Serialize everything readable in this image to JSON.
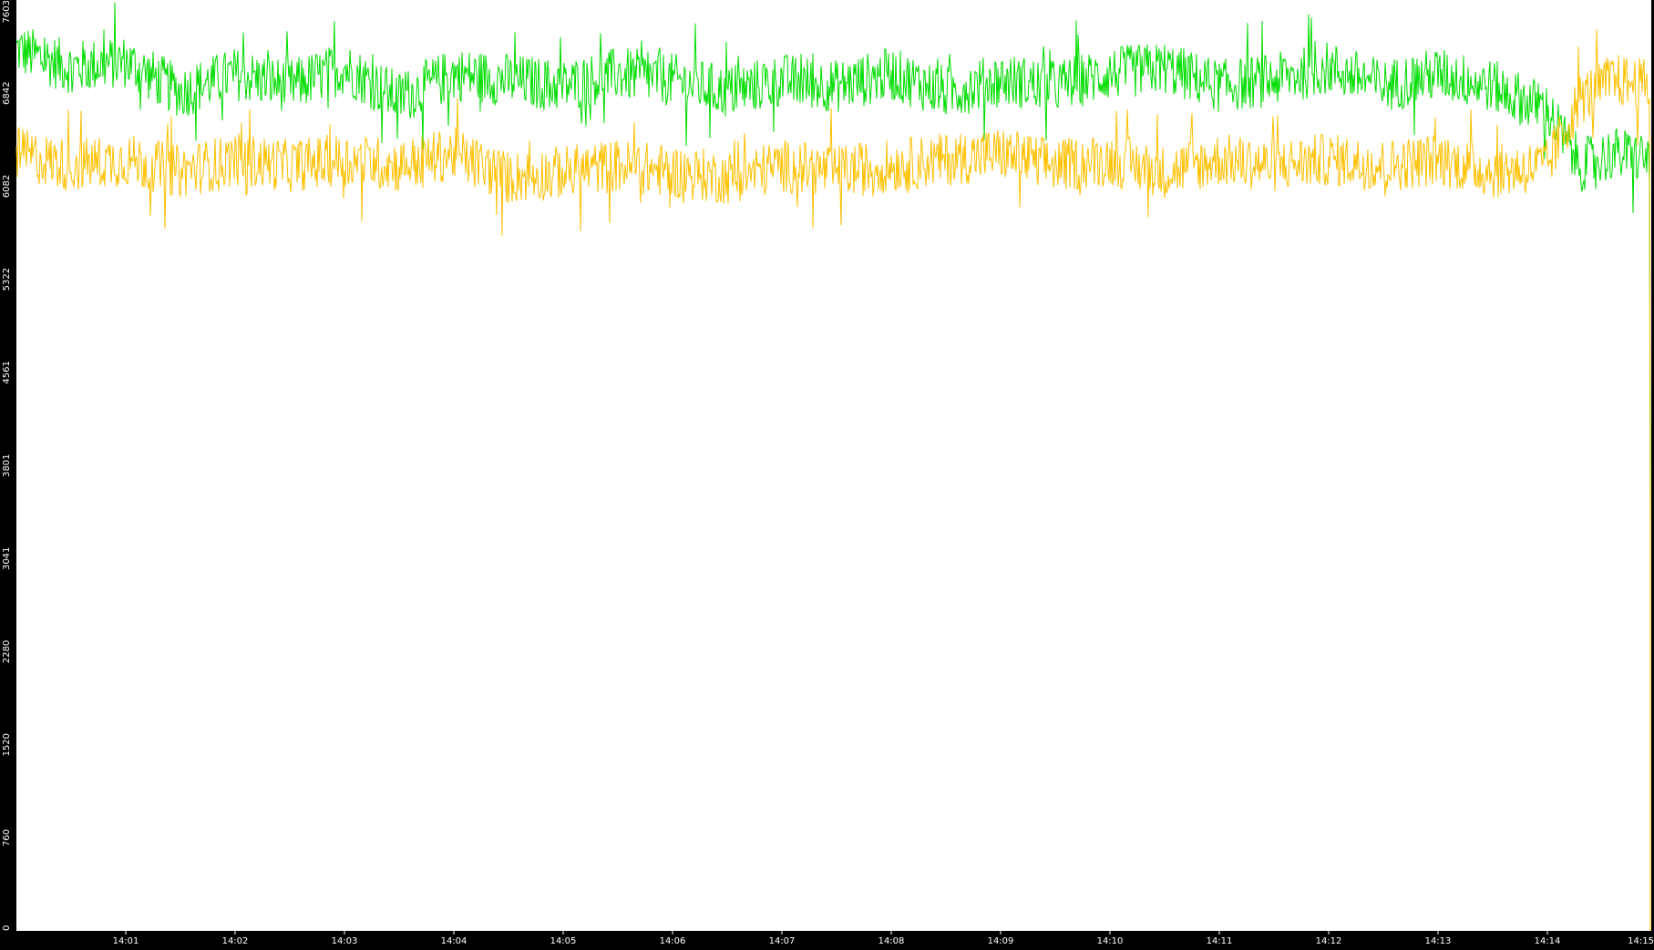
{
  "chart_data": {
    "type": "line",
    "title": "",
    "xlabel": "",
    "ylabel": "",
    "grid": false,
    "legend": "none",
    "ylim": [
      0,
      7603
    ],
    "xlim_minutes": [
      0.0,
      14.95
    ],
    "y_ticks": [
      0,
      760,
      1520,
      2280,
      3041,
      3801,
      4561,
      5322,
      6082,
      6842,
      7603
    ],
    "y_tick_labels": [
      "0",
      "760",
      "1520",
      "2280",
      "3041",
      "3801",
      "4561",
      "5322",
      "6082",
      "6842",
      "7603"
    ],
    "x_ticks_minutes": [
      1,
      2,
      3,
      4,
      5,
      6,
      7,
      8,
      9,
      10,
      11,
      12,
      13,
      14,
      15
    ],
    "x_tick_labels": [
      "14:01",
      "14:02",
      "14:03",
      "14:04",
      "14:05",
      "14:06",
      "14:07",
      "14:08",
      "14:09",
      "14:10",
      "14:11",
      "14:12",
      "14:13",
      "14:14",
      "14:15"
    ],
    "colors": {
      "plot_background": "#FFFFFF",
      "frame": "#000000",
      "tick_text": "#FFFFFF"
    },
    "series": [
      {
        "color": "#00DD00",
        "end_drop": [
          3400,
          3030
        ],
        "points": [
          [
            0.0,
            7200
          ],
          [
            0.5,
            7050
          ],
          [
            1.0,
            7100
          ],
          [
            1.5,
            6850
          ],
          [
            2.0,
            7000
          ],
          [
            2.5,
            6900
          ],
          [
            3.0,
            7050
          ],
          [
            3.5,
            6800
          ],
          [
            4.0,
            7000
          ],
          [
            4.5,
            6950
          ],
          [
            5.0,
            6900
          ],
          [
            5.5,
            7000
          ],
          [
            6.0,
            6950
          ],
          [
            6.5,
            6850
          ],
          [
            7.0,
            6950
          ],
          [
            7.5,
            6900
          ],
          [
            8.0,
            7000
          ],
          [
            8.5,
            6850
          ],
          [
            9.0,
            6950
          ],
          [
            9.5,
            6900
          ],
          [
            10.0,
            7000
          ],
          [
            10.5,
            7050
          ],
          [
            11.0,
            6900
          ],
          [
            11.5,
            6950
          ],
          [
            12.0,
            7050
          ],
          [
            12.5,
            6900
          ],
          [
            13.0,
            7000
          ],
          [
            13.5,
            6900
          ],
          [
            14.0,
            6700
          ],
          [
            14.3,
            6250
          ],
          [
            14.6,
            6350
          ],
          [
            14.95,
            6300
          ]
        ]
      },
      {
        "color": "#FFC000",
        "end_drop": [
          3200,
          0
        ],
        "points": [
          [
            0.0,
            6350
          ],
          [
            0.5,
            6250
          ],
          [
            1.0,
            6300
          ],
          [
            1.5,
            6200
          ],
          [
            2.0,
            6300
          ],
          [
            2.5,
            6250
          ],
          [
            3.0,
            6300
          ],
          [
            3.5,
            6250
          ],
          [
            4.0,
            6350
          ],
          [
            4.5,
            6150
          ],
          [
            5.0,
            6200
          ],
          [
            5.5,
            6250
          ],
          [
            6.0,
            6200
          ],
          [
            6.5,
            6150
          ],
          [
            7.0,
            6250
          ],
          [
            7.5,
            6200
          ],
          [
            8.0,
            6250
          ],
          [
            8.5,
            6300
          ],
          [
            9.0,
            6350
          ],
          [
            9.5,
            6250
          ],
          [
            10.0,
            6300
          ],
          [
            10.5,
            6200
          ],
          [
            11.0,
            6300
          ],
          [
            11.5,
            6250
          ],
          [
            12.0,
            6300
          ],
          [
            12.5,
            6250
          ],
          [
            13.0,
            6300
          ],
          [
            13.5,
            6200
          ],
          [
            14.0,
            6250
          ],
          [
            14.3,
            6800
          ],
          [
            14.6,
            6950
          ],
          [
            14.95,
            6900
          ]
        ]
      }
    ]
  }
}
